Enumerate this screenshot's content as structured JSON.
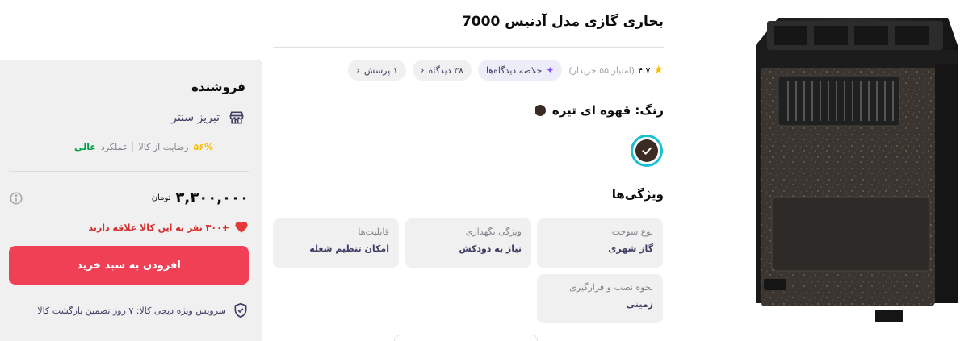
{
  "product": {
    "title": "بخاری گازی مدل آدنیس 7000",
    "image_alt": "product-heater-image"
  },
  "rating": {
    "value": "۴.۷",
    "count_text": "(امتیاز ۵۵ خریدار)"
  },
  "chips": {
    "summary": "خلاصه دیدگاه‌ها",
    "reviews": "۳۸ دیدگاه",
    "questions": "۱ پرسش"
  },
  "color": {
    "label": "رنگ: قهوه ای تیره",
    "selected_hex": "#3c2a25",
    "ring_hex": "#19bfd3"
  },
  "features": {
    "title": "ویژگی‌ها",
    "items": [
      {
        "key": "نوع سوخت",
        "value": "گاز شهری"
      },
      {
        "key": "ویژگی نگهداری",
        "value": "نیاز به دودکش"
      },
      {
        "key": "قابلیت‌ها",
        "value": "امکان تنظیم شعله"
      },
      {
        "key": "نحوه نصب و قرارگیری",
        "value": "زمینی"
      }
    ]
  },
  "seller": {
    "title": "فروشنده",
    "name": "تبریز سنتر",
    "satisfaction_pct": "۵۶%",
    "satisfaction_text": "رضایت از کالا",
    "performance_label": "عملکرد",
    "performance_value": "عالی"
  },
  "price": {
    "value": "۳,۳۰۰,۰۰۰",
    "currency": "تومان"
  },
  "interest_text": "+۳۰۰ نفر به این کالا علاقه دارند",
  "cart": {
    "add_label": "افزودن به سبد خرید"
  },
  "service_text": "سرویس ویژه دیجی کالا: ۷ روز تضمین بازگشت کالا",
  "colors": {
    "accent": "#ef4056",
    "star": "#f9bc00",
    "success": "#00a049"
  }
}
